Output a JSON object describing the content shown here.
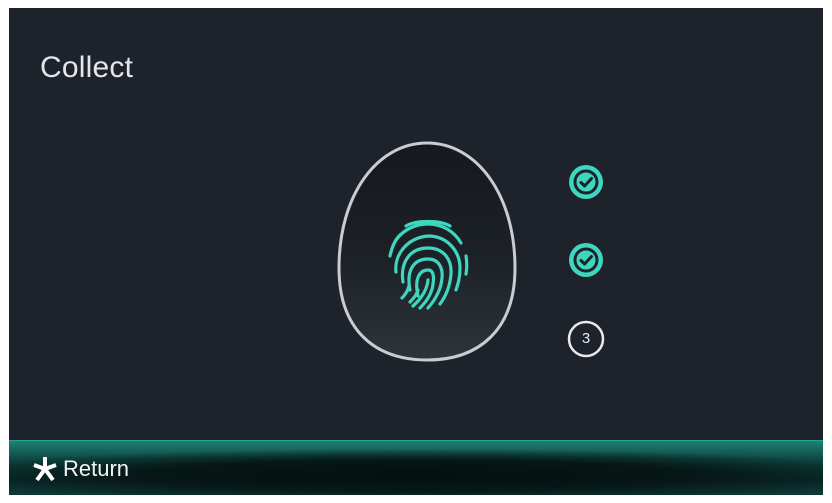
{
  "screen": {
    "title": "Collect"
  },
  "sensor": {
    "icon": "fingerprint-icon",
    "accent_color": "#3fd6bf",
    "outline_color": "#c9ccd1"
  },
  "steps": [
    {
      "status": "done",
      "icon": "check-circle-icon"
    },
    {
      "status": "done",
      "icon": "check-circle-icon"
    },
    {
      "status": "pending",
      "label": "3"
    }
  ],
  "footer": {
    "return_label": "Return",
    "return_icon": "asterisk-icon"
  },
  "colors": {
    "background": "#1e232b",
    "accent": "#3fd6bf",
    "footer": "#0f4a45"
  }
}
